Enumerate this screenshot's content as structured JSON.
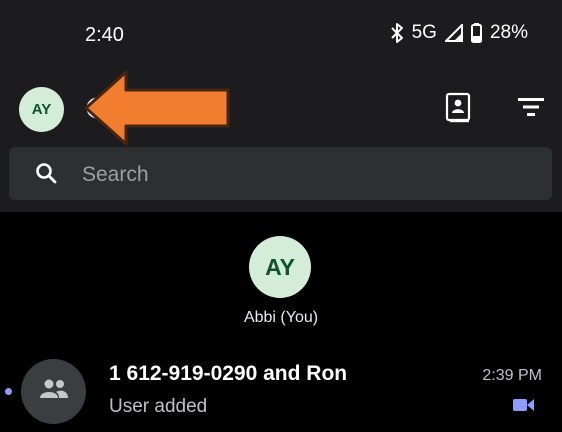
{
  "status_bar": {
    "time": "2:40",
    "network": "5G",
    "battery": "28%",
    "icons": [
      "bluetooth-icon",
      "signal-icon",
      "battery-icon"
    ]
  },
  "header": {
    "avatar_initials": "AY",
    "icons": [
      "contacts-book-icon",
      "filter-icon"
    ],
    "overlay": "orange-arrow-pointer"
  },
  "search": {
    "placeholder": "Search"
  },
  "self": {
    "initials": "AY",
    "name": "Abbi (You)"
  },
  "conversations": [
    {
      "title": "1 612-919-0290 and Ron",
      "subtitle": "User added",
      "time": "2:39 PM",
      "unread": true,
      "icon": "video-call-icon"
    }
  ],
  "colors": {
    "background": "#000000",
    "top_panel": "#1c1c1e",
    "search_bg": "#2e2f31",
    "avatar_bg": "#d4edd9",
    "avatar_text": "#0f5132",
    "accent": "#8c9eff",
    "arrow": "#f07e2e"
  }
}
